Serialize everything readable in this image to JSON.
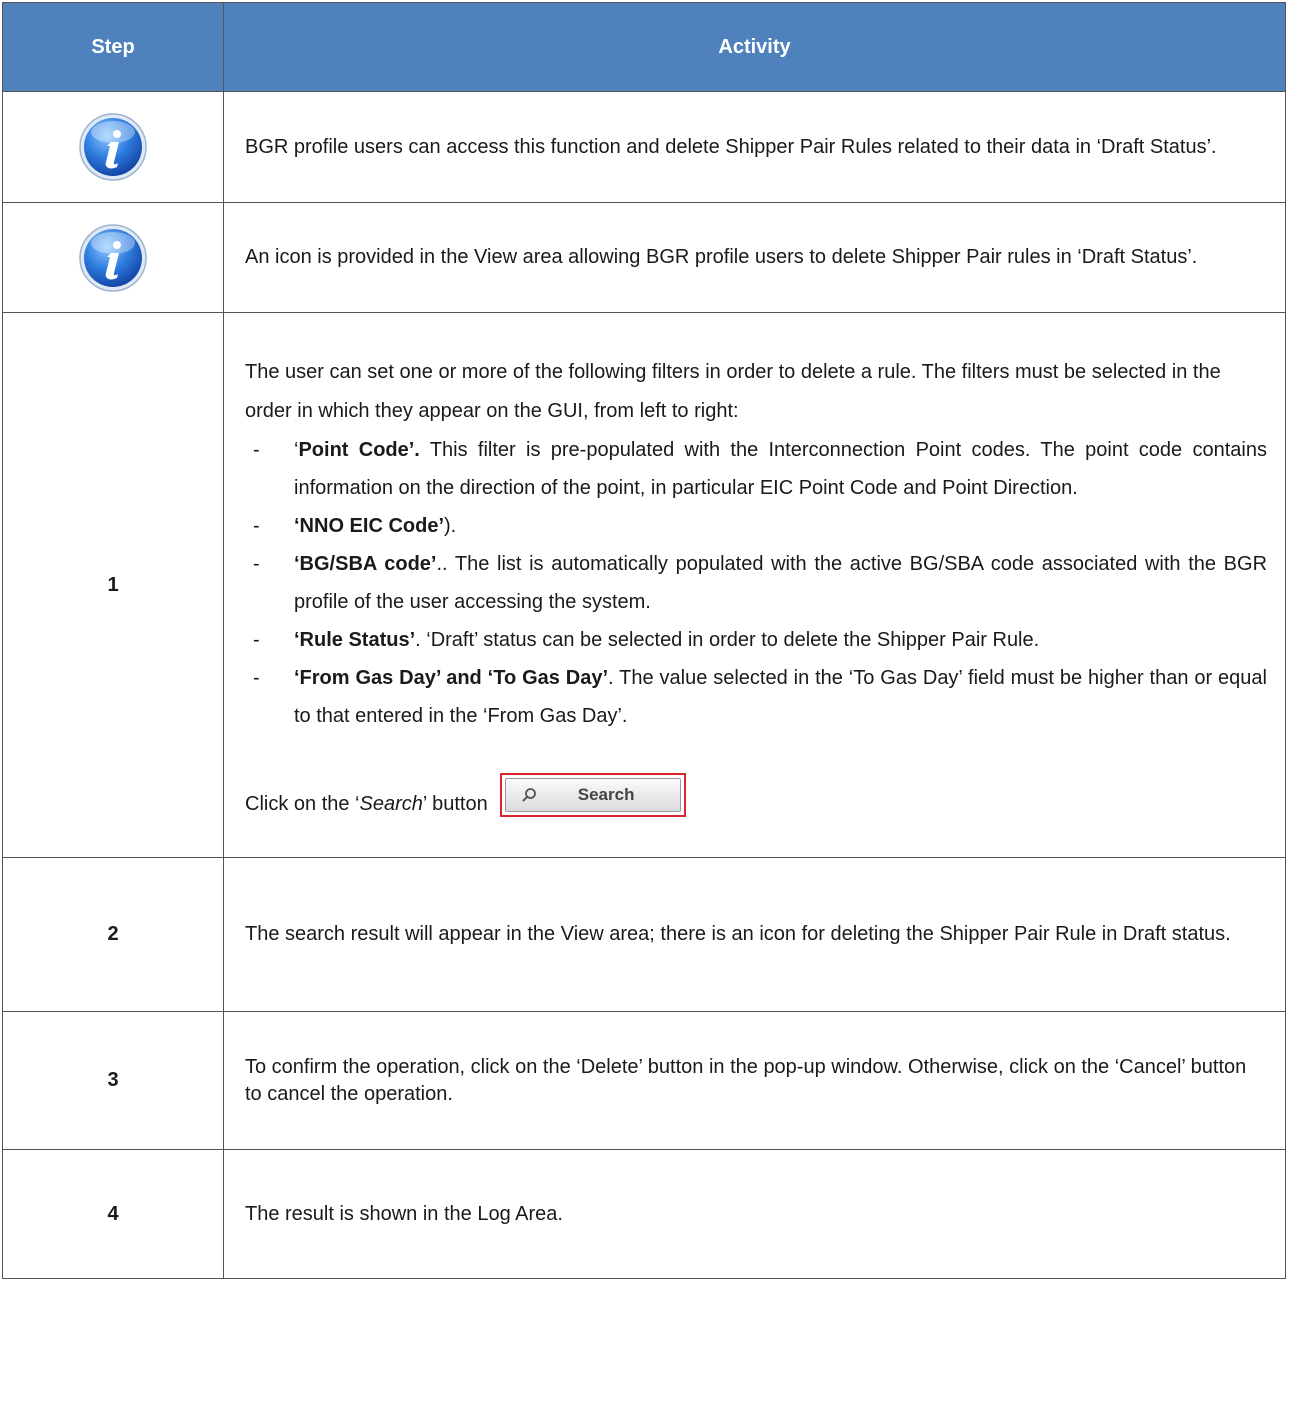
{
  "header": {
    "step": "Step",
    "activity": "Activity"
  },
  "icons": {
    "info": "info-icon",
    "search": "magnifier-icon"
  },
  "rows": {
    "info1": {
      "text": "BGR profile users can access this function and delete Shipper Pair Rules related to their data in ‘Draft Status’."
    },
    "info2": {
      "text": "An icon is provided in the View area allowing BGR profile users to delete Shipper Pair rules in ‘Draft Status’."
    },
    "step1": {
      "step": "1",
      "intro": "The user can set one or more of the following filters in order to delete a rule. The filters must be selected in the order in which they appear on the GUI, from left to right:",
      "filters": [
        {
          "pre": "‘",
          "bold": "Point Code’.",
          "text": " This filter is pre-populated with the Interconnection Point codes. The point code contains information on the direction of the point, in particular EIC Point Code  and Point Direction."
        },
        {
          "pre": "",
          "bold": "‘NNO EIC Code’",
          "text": ")."
        },
        {
          "pre": "",
          "bold": "‘BG/SBA code’",
          "text": ".. The list is automatically populated with the active BG/SBA code associated with the BGR profile of the user accessing the system."
        },
        {
          "pre": "",
          "bold": "‘Rule Status’",
          "text": ". ‘Draft’ status can be selected in order to delete the Shipper Pair Rule."
        },
        {
          "pre": "",
          "bold": "‘From Gas Day’ and ‘To Gas Day’",
          "text": ". The value selected in the ‘To Gas Day’ field must be higher than or equal to that entered in the ‘From Gas Day’."
        }
      ],
      "click_pre": "Click on the ‘",
      "click_italic": "Search",
      "click_post": "’ button",
      "search_button_label": "Search"
    },
    "step2": {
      "step": "2",
      "text": "The search result will appear in the View area; there is an icon for deleting the Shipper Pair Rule in Draft status."
    },
    "step3": {
      "step": "3",
      "text": "To confirm the operation, click on the ‘Delete’ button in the pop-up window. Otherwise, click on the ‘Cancel’ button to cancel the operation."
    },
    "step4": {
      "step": "4",
      "text": "The result is shown in the Log Area."
    }
  }
}
